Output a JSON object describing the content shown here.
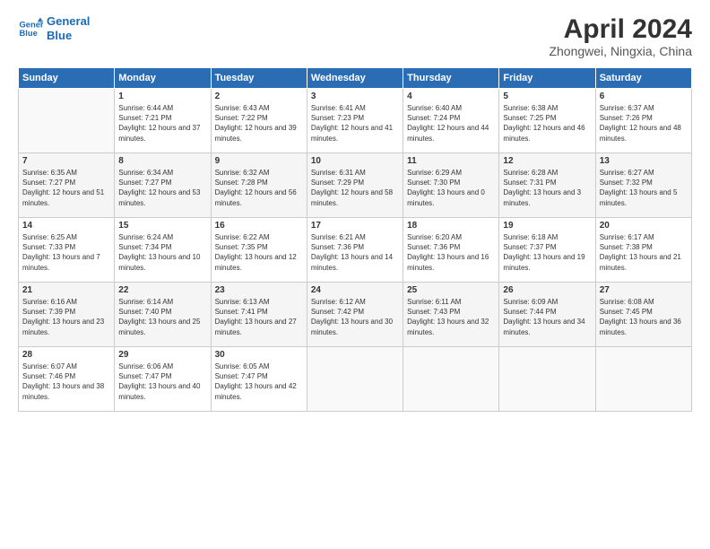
{
  "logo": {
    "line1": "General",
    "line2": "Blue"
  },
  "title": "April 2024",
  "subtitle": "Zhongwei, Ningxia, China",
  "headers": [
    "Sunday",
    "Monday",
    "Tuesday",
    "Wednesday",
    "Thursday",
    "Friday",
    "Saturday"
  ],
  "weeks": [
    [
      {
        "num": "",
        "sunrise": "",
        "sunset": "",
        "daylight": ""
      },
      {
        "num": "1",
        "sunrise": "Sunrise: 6:44 AM",
        "sunset": "Sunset: 7:21 PM",
        "daylight": "Daylight: 12 hours and 37 minutes."
      },
      {
        "num": "2",
        "sunrise": "Sunrise: 6:43 AM",
        "sunset": "Sunset: 7:22 PM",
        "daylight": "Daylight: 12 hours and 39 minutes."
      },
      {
        "num": "3",
        "sunrise": "Sunrise: 6:41 AM",
        "sunset": "Sunset: 7:23 PM",
        "daylight": "Daylight: 12 hours and 41 minutes."
      },
      {
        "num": "4",
        "sunrise": "Sunrise: 6:40 AM",
        "sunset": "Sunset: 7:24 PM",
        "daylight": "Daylight: 12 hours and 44 minutes."
      },
      {
        "num": "5",
        "sunrise": "Sunrise: 6:38 AM",
        "sunset": "Sunset: 7:25 PM",
        "daylight": "Daylight: 12 hours and 46 minutes."
      },
      {
        "num": "6",
        "sunrise": "Sunrise: 6:37 AM",
        "sunset": "Sunset: 7:26 PM",
        "daylight": "Daylight: 12 hours and 48 minutes."
      }
    ],
    [
      {
        "num": "7",
        "sunrise": "Sunrise: 6:35 AM",
        "sunset": "Sunset: 7:27 PM",
        "daylight": "Daylight: 12 hours and 51 minutes."
      },
      {
        "num": "8",
        "sunrise": "Sunrise: 6:34 AM",
        "sunset": "Sunset: 7:27 PM",
        "daylight": "Daylight: 12 hours and 53 minutes."
      },
      {
        "num": "9",
        "sunrise": "Sunrise: 6:32 AM",
        "sunset": "Sunset: 7:28 PM",
        "daylight": "Daylight: 12 hours and 56 minutes."
      },
      {
        "num": "10",
        "sunrise": "Sunrise: 6:31 AM",
        "sunset": "Sunset: 7:29 PM",
        "daylight": "Daylight: 12 hours and 58 minutes."
      },
      {
        "num": "11",
        "sunrise": "Sunrise: 6:29 AM",
        "sunset": "Sunset: 7:30 PM",
        "daylight": "Daylight: 13 hours and 0 minutes."
      },
      {
        "num": "12",
        "sunrise": "Sunrise: 6:28 AM",
        "sunset": "Sunset: 7:31 PM",
        "daylight": "Daylight: 13 hours and 3 minutes."
      },
      {
        "num": "13",
        "sunrise": "Sunrise: 6:27 AM",
        "sunset": "Sunset: 7:32 PM",
        "daylight": "Daylight: 13 hours and 5 minutes."
      }
    ],
    [
      {
        "num": "14",
        "sunrise": "Sunrise: 6:25 AM",
        "sunset": "Sunset: 7:33 PM",
        "daylight": "Daylight: 13 hours and 7 minutes."
      },
      {
        "num": "15",
        "sunrise": "Sunrise: 6:24 AM",
        "sunset": "Sunset: 7:34 PM",
        "daylight": "Daylight: 13 hours and 10 minutes."
      },
      {
        "num": "16",
        "sunrise": "Sunrise: 6:22 AM",
        "sunset": "Sunset: 7:35 PM",
        "daylight": "Daylight: 13 hours and 12 minutes."
      },
      {
        "num": "17",
        "sunrise": "Sunrise: 6:21 AM",
        "sunset": "Sunset: 7:36 PM",
        "daylight": "Daylight: 13 hours and 14 minutes."
      },
      {
        "num": "18",
        "sunrise": "Sunrise: 6:20 AM",
        "sunset": "Sunset: 7:36 PM",
        "daylight": "Daylight: 13 hours and 16 minutes."
      },
      {
        "num": "19",
        "sunrise": "Sunrise: 6:18 AM",
        "sunset": "Sunset: 7:37 PM",
        "daylight": "Daylight: 13 hours and 19 minutes."
      },
      {
        "num": "20",
        "sunrise": "Sunrise: 6:17 AM",
        "sunset": "Sunset: 7:38 PM",
        "daylight": "Daylight: 13 hours and 21 minutes."
      }
    ],
    [
      {
        "num": "21",
        "sunrise": "Sunrise: 6:16 AM",
        "sunset": "Sunset: 7:39 PM",
        "daylight": "Daylight: 13 hours and 23 minutes."
      },
      {
        "num": "22",
        "sunrise": "Sunrise: 6:14 AM",
        "sunset": "Sunset: 7:40 PM",
        "daylight": "Daylight: 13 hours and 25 minutes."
      },
      {
        "num": "23",
        "sunrise": "Sunrise: 6:13 AM",
        "sunset": "Sunset: 7:41 PM",
        "daylight": "Daylight: 13 hours and 27 minutes."
      },
      {
        "num": "24",
        "sunrise": "Sunrise: 6:12 AM",
        "sunset": "Sunset: 7:42 PM",
        "daylight": "Daylight: 13 hours and 30 minutes."
      },
      {
        "num": "25",
        "sunrise": "Sunrise: 6:11 AM",
        "sunset": "Sunset: 7:43 PM",
        "daylight": "Daylight: 13 hours and 32 minutes."
      },
      {
        "num": "26",
        "sunrise": "Sunrise: 6:09 AM",
        "sunset": "Sunset: 7:44 PM",
        "daylight": "Daylight: 13 hours and 34 minutes."
      },
      {
        "num": "27",
        "sunrise": "Sunrise: 6:08 AM",
        "sunset": "Sunset: 7:45 PM",
        "daylight": "Daylight: 13 hours and 36 minutes."
      }
    ],
    [
      {
        "num": "28",
        "sunrise": "Sunrise: 6:07 AM",
        "sunset": "Sunset: 7:46 PM",
        "daylight": "Daylight: 13 hours and 38 minutes."
      },
      {
        "num": "29",
        "sunrise": "Sunrise: 6:06 AM",
        "sunset": "Sunset: 7:47 PM",
        "daylight": "Daylight: 13 hours and 40 minutes."
      },
      {
        "num": "30",
        "sunrise": "Sunrise: 6:05 AM",
        "sunset": "Sunset: 7:47 PM",
        "daylight": "Daylight: 13 hours and 42 minutes."
      },
      {
        "num": "",
        "sunrise": "",
        "sunset": "",
        "daylight": ""
      },
      {
        "num": "",
        "sunrise": "",
        "sunset": "",
        "daylight": ""
      },
      {
        "num": "",
        "sunrise": "",
        "sunset": "",
        "daylight": ""
      },
      {
        "num": "",
        "sunrise": "",
        "sunset": "",
        "daylight": ""
      }
    ]
  ]
}
